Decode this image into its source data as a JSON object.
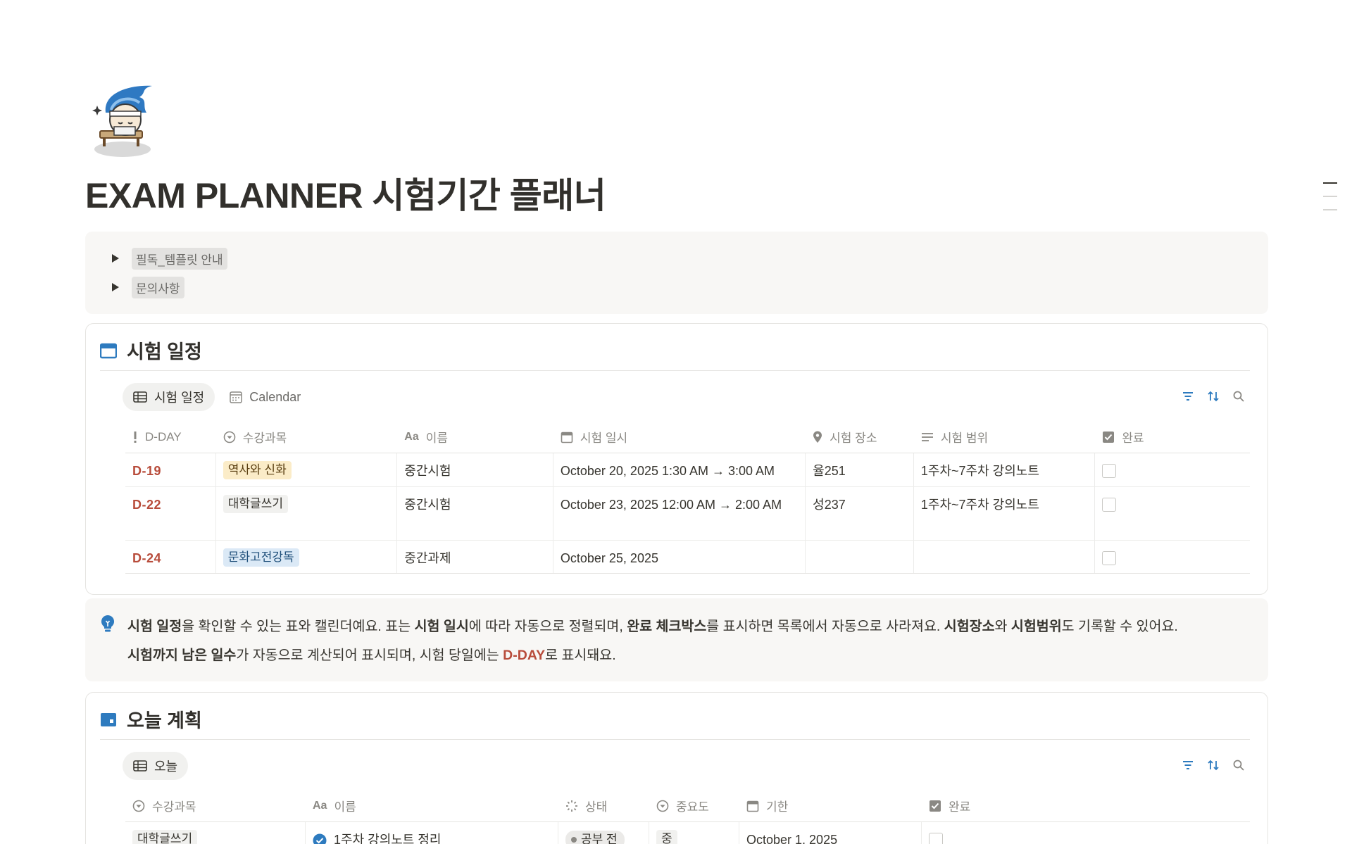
{
  "page": {
    "title": "EXAM PLANNER 시험기간 플래너"
  },
  "toggles": [
    {
      "label": "필독_템플릿 안내"
    },
    {
      "label": "문의사항"
    }
  ],
  "exam_db": {
    "title": "시험 일정",
    "views": [
      {
        "label": "시험 일정",
        "active": true,
        "icon": "table-icon"
      },
      {
        "label": "Calendar",
        "active": false,
        "icon": "calendar-icon"
      }
    ],
    "columns": [
      "D-DAY",
      "수강과목",
      "이름",
      "시험 일시",
      "시험 장소",
      "시험 범위",
      "완료"
    ],
    "rows": [
      {
        "dday": "D-19",
        "subject": "역사와 신화",
        "subject_color": "#fbecc8",
        "name": "중간시험",
        "datetime": "October 20, 2025 1:30 AM → 3:00 AM",
        "place": "율251",
        "range": "1주차~7주차 강의노트",
        "done": false
      },
      {
        "dday": "D-22",
        "subject": "대학글쓰기",
        "subject_color": "#f1f1ef",
        "name": "중간시험",
        "datetime": "October 23, 2025 12:00 AM → 2:00 AM",
        "place": "성237",
        "range": "1주차~7주차 강의노트",
        "done": false
      },
      {
        "dday": "D-24",
        "subject": "문화고전강독",
        "subject_color": "#dbe9f6",
        "name": "중간과제",
        "datetime": "October 25, 2025",
        "place": "",
        "range": "",
        "done": false
      }
    ]
  },
  "info": {
    "p1_b1": "시험 일정",
    "p1_t1": "을 확인할 수 있는 표와 캘린더예요. 표는 ",
    "p1_b2": "시험 일시",
    "p1_t2": "에 따라 자동으로 정렬되며, ",
    "p1_b3": "완료 체크박스",
    "p1_t3": "를 표시하면 목록에서 자동으로 사라져요. ",
    "p1_b4": "시험장소",
    "p1_t4": "와 ",
    "p1_b5": "시험범위",
    "p1_t5": "도 기록할 수 있어요.",
    "p2_b1": "시험까지 남은 일수",
    "p2_t1": "가 자동으로 계산되어 표시되며, 시험 당일에는 ",
    "p2_red": "D-DAY",
    "p2_t2": "로 표시돼요."
  },
  "today_db": {
    "title": "오늘 계획",
    "views": [
      {
        "label": "오늘",
        "active": true,
        "icon": "table-icon"
      }
    ],
    "columns": [
      "수강과목",
      "이름",
      "상태",
      "중요도",
      "기한",
      "완료"
    ],
    "rows": [
      {
        "subject": "대학글쓰기",
        "name": "1주차 강의노트 정리",
        "status": "공부 전",
        "priority": "중",
        "due": "October 1, 2025",
        "done": false
      }
    ]
  },
  "colors": {
    "accent_blue": "#2e7bbf",
    "dday_red": "#b84c3b"
  }
}
